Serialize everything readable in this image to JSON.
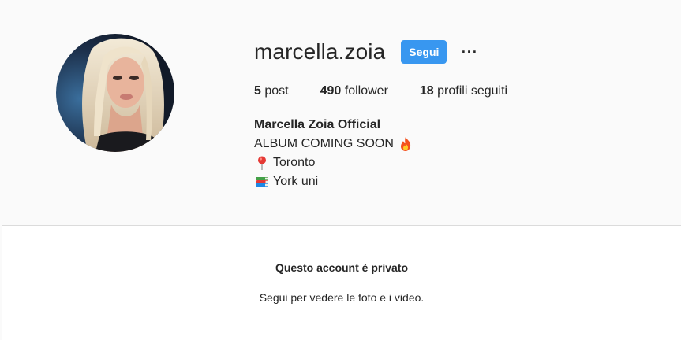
{
  "profile": {
    "username": "marcella.zoia",
    "follow_label": "Segui",
    "more_label": "···",
    "avatar_icon": "profile-photo"
  },
  "stats": {
    "posts": {
      "count": "5",
      "label": "post"
    },
    "followers": {
      "count": "490",
      "label": "follower"
    },
    "following": {
      "count": "18",
      "label": "profili seguiti"
    }
  },
  "bio": {
    "name": "Marcella Zoia Official",
    "line1": {
      "text": "ALBUM COMING SOON",
      "icon": "fire-icon"
    },
    "line2": {
      "text": "Toronto",
      "icon": "pin-icon"
    },
    "line3": {
      "text": "York uni",
      "icon": "books-icon"
    }
  },
  "private": {
    "title": "Questo account è privato",
    "subtitle": "Segui per vedere le foto e i video."
  },
  "colors": {
    "background": "#fafafa",
    "accent": "#3897f0",
    "text": "#262626",
    "border": "#dbdbdb"
  }
}
